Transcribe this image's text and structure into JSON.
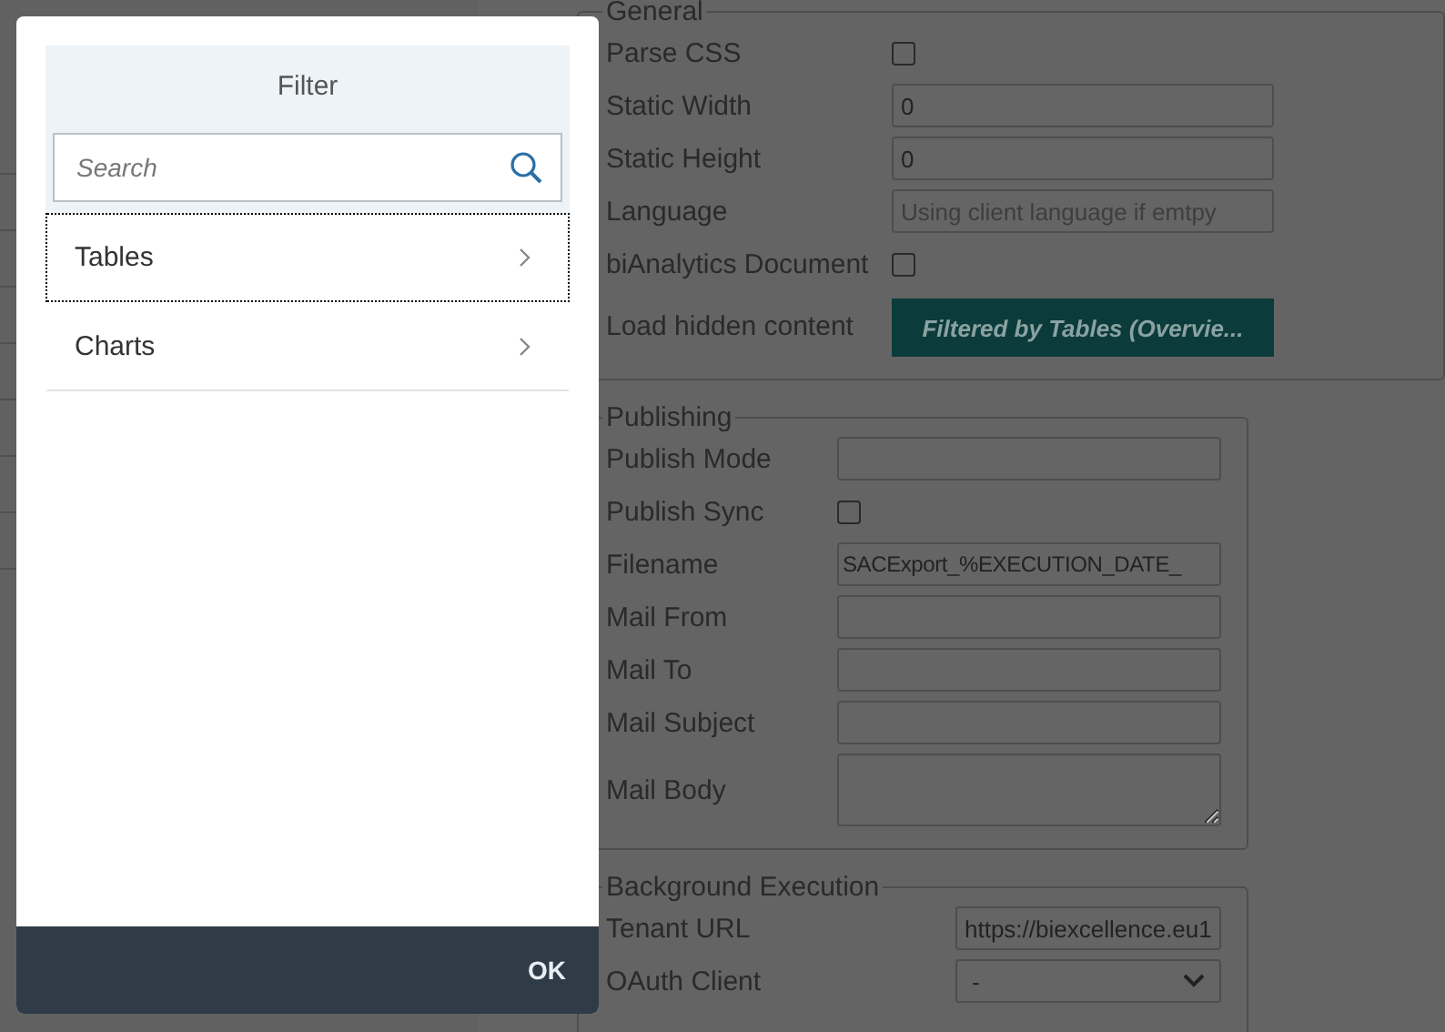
{
  "sections": [
    {
      "legend": "General",
      "fields": [
        {
          "label": "Parse CSS",
          "kind": "checkbox",
          "checked": false
        },
        {
          "label": "Static Width",
          "kind": "text",
          "value": "0"
        },
        {
          "label": "Static Height",
          "kind": "text",
          "value": "0"
        },
        {
          "label": "Language",
          "kind": "text",
          "placeholder": "Using client language if emtpy"
        },
        {
          "label": "biAnalytics Document",
          "kind": "checkbox",
          "checked": false
        },
        {
          "label": "Load hidden content",
          "kind": "button",
          "value": "Filtered by Tables (Overvie..."
        }
      ]
    },
    {
      "legend": "Publishing",
      "fields": [
        {
          "label": "Publish Mode",
          "kind": "text"
        },
        {
          "label": "Publish Sync",
          "kind": "checkbox",
          "checked": false
        },
        {
          "label": "Filename",
          "kind": "text",
          "value": "SACExport_%EXECUTION_DATE_"
        },
        {
          "label": "Mail From",
          "kind": "text"
        },
        {
          "label": "Mail To",
          "kind": "text"
        },
        {
          "label": "Mail Subject",
          "kind": "text"
        },
        {
          "label": "Mail Body",
          "kind": "textarea"
        }
      ]
    },
    {
      "legend": "Background Execution",
      "fields": [
        {
          "label": "Tenant URL",
          "kind": "text",
          "value": "https://biexcellence.eu1"
        },
        {
          "label": "OAuth Client",
          "kind": "select",
          "value": "-"
        }
      ]
    }
  ],
  "dialog": {
    "title": "Filter",
    "search": {
      "placeholder": "Search"
    },
    "items": [
      {
        "label": "Tables",
        "focused": true
      },
      {
        "label": "Charts",
        "focused": false
      }
    ],
    "ok": "OK"
  }
}
